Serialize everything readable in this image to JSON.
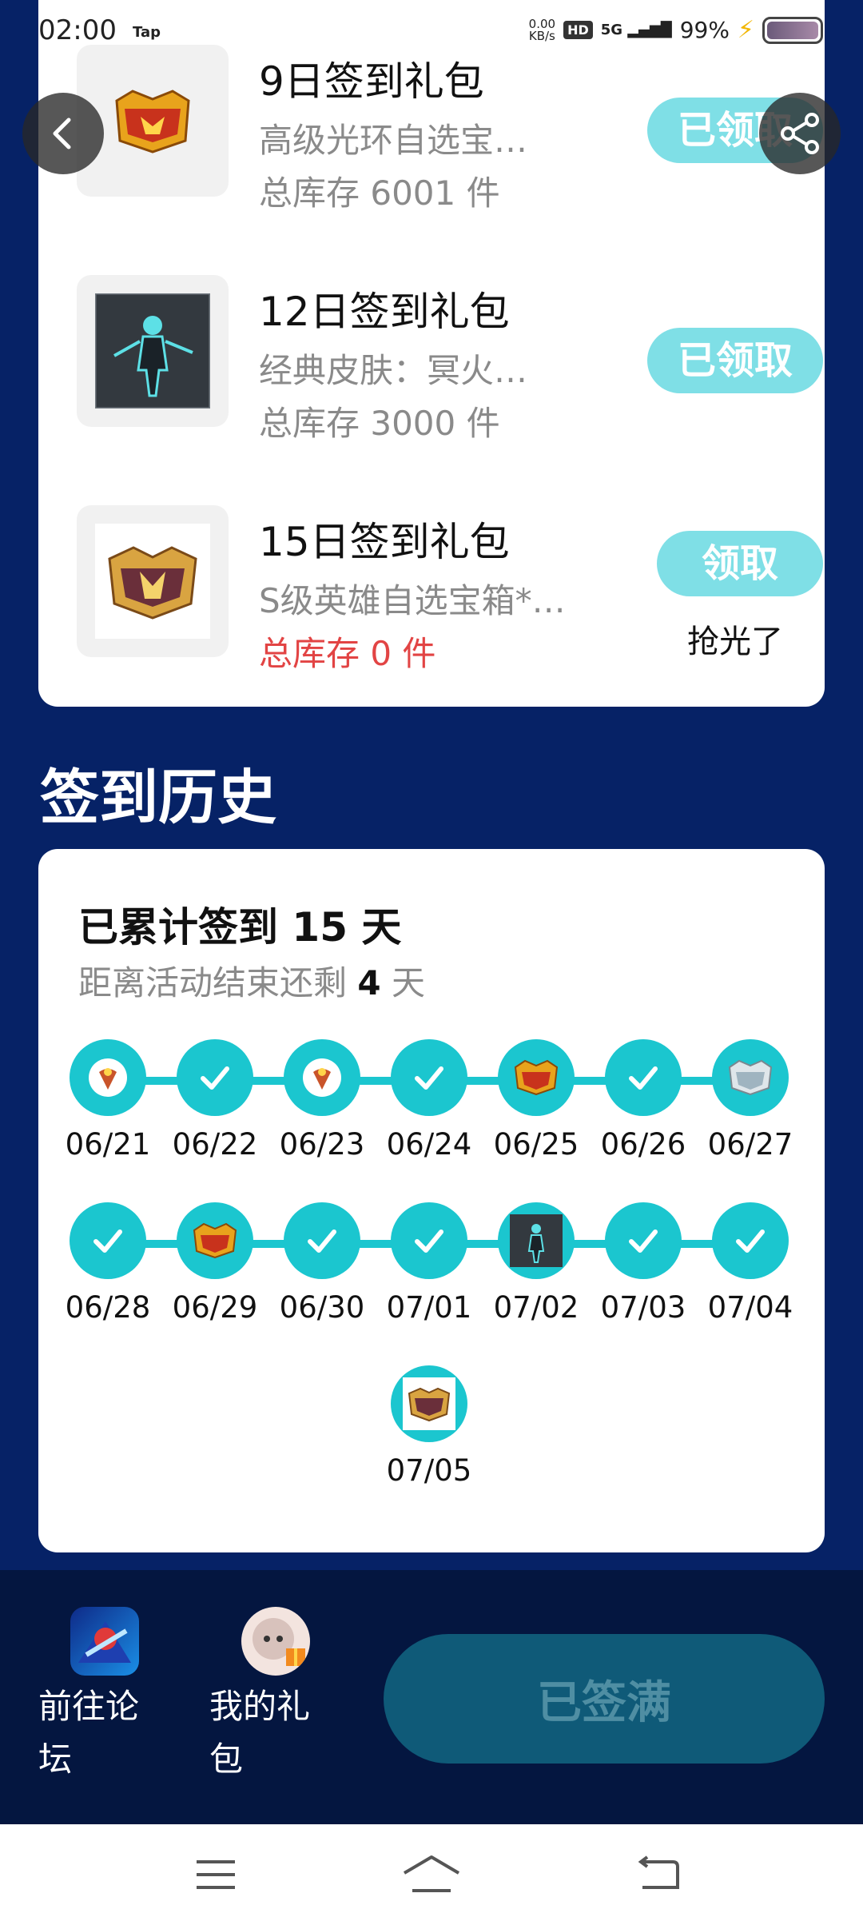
{
  "status_bar": {
    "time": "02:00",
    "app_tag": "Tap",
    "net_speed": "0.00",
    "net_unit": "KB/s",
    "hd": "HD",
    "signal": "5G",
    "battery": "99%"
  },
  "gifts": [
    {
      "title": "9日签到礼包",
      "desc": "高级光环自选宝…",
      "stock": "总库存 6001 件",
      "button": "已领取",
      "icon": "golden-chest-icon"
    },
    {
      "title": "12日签到礼包",
      "desc": "经典皮肤：冥火…",
      "stock": "总库存 3000 件",
      "button": "已领取",
      "icon": "skin-portrait-icon"
    },
    {
      "title": "15日签到礼包",
      "desc": "S级英雄自选宝箱*…",
      "stock": "总库存 0 件",
      "button": "领取",
      "note": "抢光了",
      "icon": "hero-chest-icon"
    }
  ],
  "history": {
    "section_title": "签到历史",
    "total_text": "已累计签到 15 天",
    "remain_prefix": "距离活动结束还剩",
    "remain_days": "4",
    "remain_suffix": "天",
    "days": [
      {
        "date": "06/21",
        "icon": "reward-item-icon"
      },
      {
        "date": "06/22",
        "icon": "check-icon"
      },
      {
        "date": "06/23",
        "icon": "reward-item-icon"
      },
      {
        "date": "06/24",
        "icon": "check-icon"
      },
      {
        "date": "06/25",
        "icon": "golden-chest-icon"
      },
      {
        "date": "06/26",
        "icon": "check-icon"
      },
      {
        "date": "06/27",
        "icon": "silver-chest-icon"
      },
      {
        "date": "06/28",
        "icon": "check-icon"
      },
      {
        "date": "06/29",
        "icon": "golden-chest-icon"
      },
      {
        "date": "06/30",
        "icon": "check-icon"
      },
      {
        "date": "07/01",
        "icon": "check-icon"
      },
      {
        "date": "07/02",
        "icon": "skin-portrait-icon"
      },
      {
        "date": "07/03",
        "icon": "check-icon"
      },
      {
        "date": "07/04",
        "icon": "check-icon"
      },
      {
        "date": "07/05",
        "icon": "hero-chest-icon"
      }
    ]
  },
  "bottom_bar": {
    "forum_label": "前往论坛",
    "gifts_label": "我的礼包",
    "signed_button": "已签满"
  },
  "colors": {
    "background": "#062266",
    "accent": "#1bc6cf",
    "pill": "#7fdfe6",
    "danger": "#e24444"
  }
}
